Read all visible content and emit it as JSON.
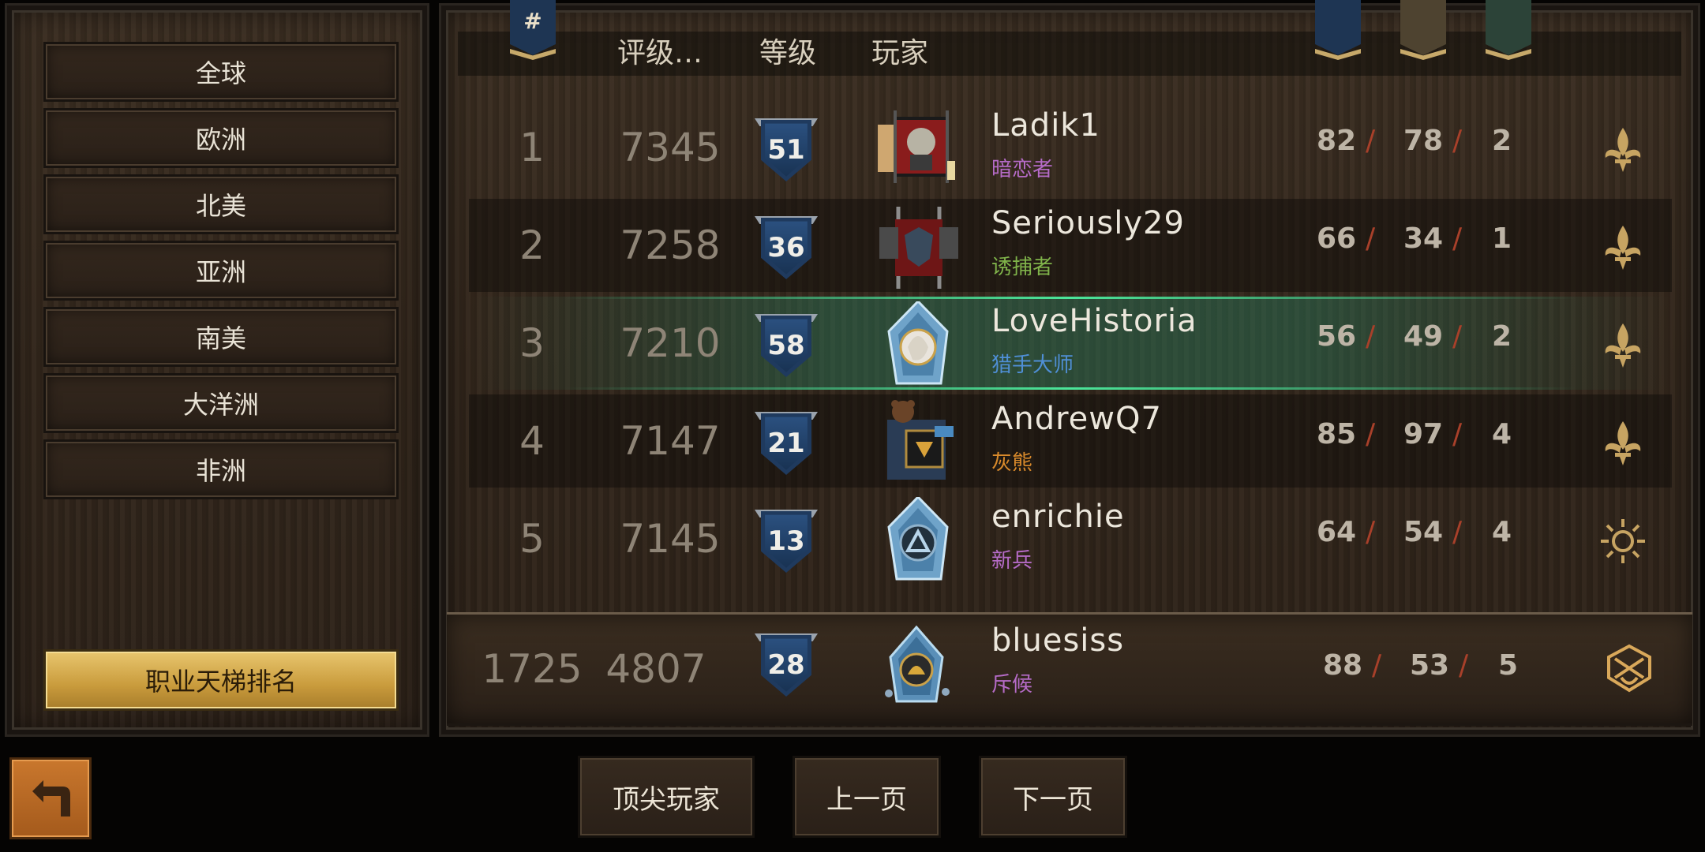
{
  "regions": [
    "全球",
    "欧洲",
    "北美",
    "亚洲",
    "南美",
    "大洋洲",
    "非洲"
  ],
  "ladder_button": "职业天梯排名",
  "header": {
    "rank_symbol": "#",
    "rating": "评级…",
    "level": "等级",
    "player": "玩家"
  },
  "rows": [
    {
      "rank": "1",
      "rating": "7345",
      "level": "51",
      "name": "Ladik1",
      "title": "暗恋者",
      "title_color": "#b56bc7",
      "wins": "82",
      "losses": "78",
      "draws": "2",
      "faction": "fleur-icon",
      "avatar": "portrait-frame-icon",
      "style": "plain"
    },
    {
      "rank": "2",
      "rating": "7258",
      "level": "36",
      "name": "Seriously29",
      "title": "诱捕者",
      "title_color": "#7fb24a",
      "wins": "66",
      "losses": "34",
      "draws": "1",
      "faction": "fleur-icon",
      "avatar": "wolf-banner-icon",
      "style": "dark"
    },
    {
      "rank": "3",
      "rating": "7210",
      "level": "58",
      "name": "LoveHistoria",
      "title": "猎手大师",
      "title_color": "#4f8fd6",
      "wins": "56",
      "losses": "49",
      "draws": "2",
      "faction": "fleur-icon",
      "avatar": "crystal-portrait-icon",
      "style": "highlight"
    },
    {
      "rank": "4",
      "rating": "7147",
      "level": "21",
      "name": "AndrewQ7",
      "title": "灰熊",
      "title_color": "#d98a2b",
      "wins": "85",
      "losses": "97",
      "draws": "4",
      "faction": "fleur-icon",
      "avatar": "bear-banner-icon",
      "style": "dark"
    },
    {
      "rank": "5",
      "rating": "7145",
      "level": "13",
      "name": "enrichie",
      "title": "新兵",
      "title_color": "#b56bc7",
      "wins": "64",
      "losses": "54",
      "draws": "4",
      "faction": "sun-icon",
      "avatar": "crystal-triangle-icon",
      "style": "plain"
    }
  ],
  "player": {
    "rank": "1725",
    "rating": "4807",
    "level": "28",
    "name": "bluesiss",
    "title": "斥候",
    "title_color": "#b56bc7",
    "wins": "88",
    "losses": "53",
    "draws": "5",
    "faction": "shield-emblem-icon",
    "avatar": "crystal-emblem-icon"
  },
  "slash": "/",
  "nav": {
    "top_players": "顶尖玩家",
    "prev_page": "上一页",
    "next_page": "下一页"
  },
  "colors": {
    "highlight": "#4be69a",
    "gold": "#c99b3c",
    "banner_blue": "#1e3553",
    "banner_brown": "#4e4330",
    "banner_green": "#2c4338"
  }
}
